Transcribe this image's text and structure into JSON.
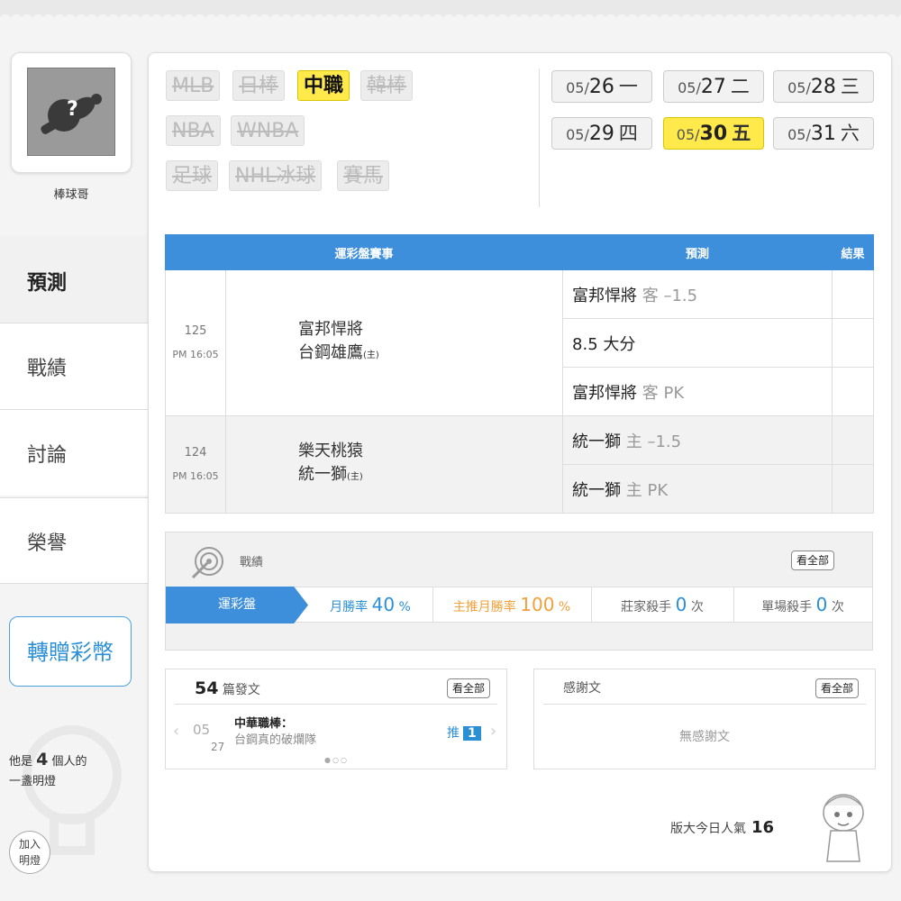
{
  "user": {
    "name": "棒球哥"
  },
  "nav": [
    {
      "label": "預測",
      "active": true
    },
    {
      "label": "戰績"
    },
    {
      "label": "討論"
    },
    {
      "label": "榮譽"
    }
  ],
  "gift_button": "轉贈彩幣",
  "lamp": {
    "prefix": "他是",
    "count": "4",
    "suffix": "個人的",
    "line2": "一盞明燈",
    "join_line1": "加入",
    "join_line2": "明燈"
  },
  "leagues": [
    "MLB",
    "日棒",
    "中職",
    "韓棒",
    "NBA",
    "WNBA",
    "足球",
    "NHL冰球",
    "賽馬"
  ],
  "selected_league": "中職",
  "dates": [
    {
      "md": "05/",
      "d": "26",
      "wd": "一"
    },
    {
      "md": "05/",
      "d": "27",
      "wd": "二"
    },
    {
      "md": "05/",
      "d": "28",
      "wd": "三"
    },
    {
      "md": "05/",
      "d": "29",
      "wd": "四"
    },
    {
      "md": "05/",
      "d": "30",
      "wd": "五",
      "selected": true
    },
    {
      "md": "05/",
      "d": "31",
      "wd": "六"
    }
  ],
  "table": {
    "headers": [
      "運彩盤賽事",
      "預測",
      "結果"
    ],
    "games": [
      {
        "no": "125",
        "time": "PM 16:05",
        "away": "富邦悍將",
        "home": "台鋼雄鷹",
        "home_tag": "(主)",
        "preds": [
          {
            "team": "富邦悍將",
            "tag": "客 –1.5"
          },
          {
            "team": "8.5 大分",
            "tag": ""
          },
          {
            "team": "富邦悍將",
            "tag": "客 PK"
          }
        ]
      },
      {
        "no": "124",
        "time": "PM 16:05",
        "away": "樂天桃猿",
        "home": "統一獅",
        "home_tag": "(主)",
        "preds": [
          {
            "team": "統一獅",
            "tag": "主 –1.5"
          },
          {
            "team": "統一獅",
            "tag": "主 PK"
          }
        ]
      }
    ]
  },
  "record": {
    "title": "戰績",
    "see_all": "看全部",
    "tab": "運彩盤",
    "stats": [
      {
        "label": "月勝率",
        "value": "40",
        "unit": "%"
      },
      {
        "label": "主推月勝率",
        "value": "100",
        "unit": "%"
      },
      {
        "label": "莊家殺手",
        "value": "0",
        "unit": "次"
      },
      {
        "label": "單場殺手",
        "value": "0",
        "unit": "次"
      }
    ]
  },
  "posts": {
    "count": "54",
    "label": "篇發文",
    "see_all": "看全部",
    "item": {
      "month": "05",
      "day": "27",
      "title": "中華職棒：",
      "subtitle": "台鋼真的破爛隊",
      "push_label": "推",
      "push_count": "1"
    }
  },
  "thanks": {
    "title": "感謝文",
    "see_all": "看全部",
    "empty": "無感謝文"
  },
  "popularity": {
    "label": "版大今日人氣",
    "value": "16"
  },
  "colors": {
    "accent": "#3d8fdb",
    "highlight": "#ffe94b",
    "orange": "#f2a03a"
  }
}
